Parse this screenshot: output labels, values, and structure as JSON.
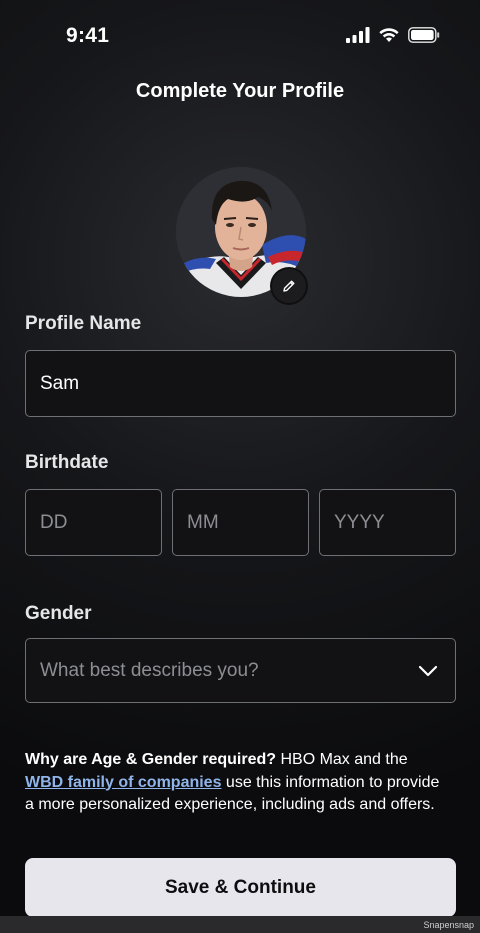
{
  "status_bar": {
    "time": "9:41"
  },
  "header": {
    "title": "Complete Your Profile"
  },
  "profile_name": {
    "label": "Profile Name",
    "value": "Sam"
  },
  "birthdate": {
    "label": "Birthdate",
    "day_placeholder": "DD",
    "month_placeholder": "MM",
    "year_placeholder": "YYYY"
  },
  "gender": {
    "label": "Gender",
    "placeholder": "What best describes you?"
  },
  "info": {
    "question": "Why are Age & Gender required?",
    "text_1": " HBO Max and the ",
    "link": "WBD family of companies",
    "text_2": " use this information to provide a more personalized experience, including ads and offers."
  },
  "footer": {
    "save_label": "Save & Continue",
    "watermark": "Snapensnap"
  }
}
